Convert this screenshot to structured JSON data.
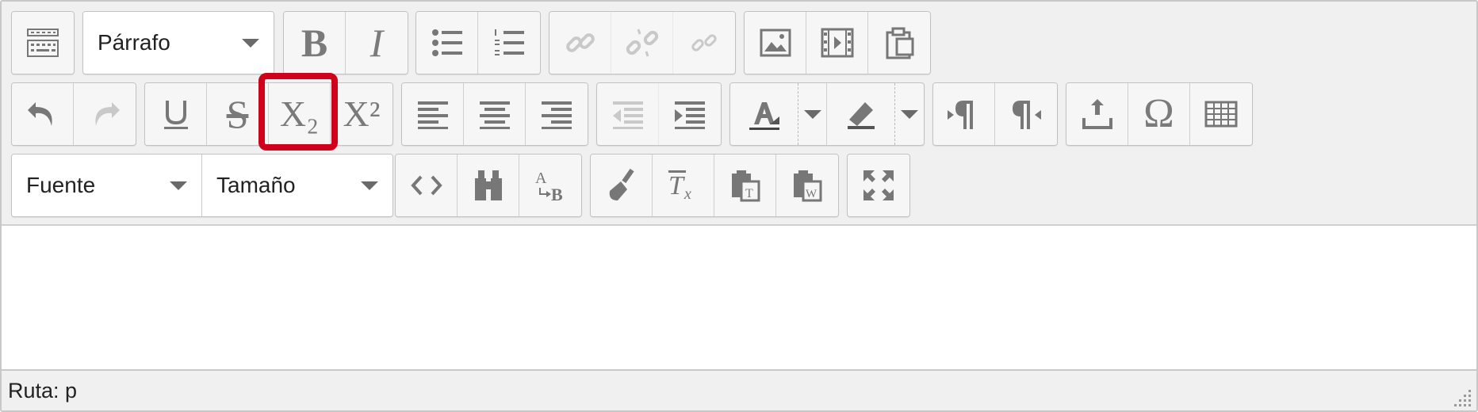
{
  "toolbar": {
    "row1": {
      "toggle_label": "Mostrar más botones",
      "format_select": "Párrafo",
      "bold": "B",
      "italic": "I"
    },
    "row2": {
      "strike": "S",
      "subscript": "X₂",
      "superscript": "X²",
      "special_char": "Ω"
    },
    "row3": {
      "font_select": "Fuente",
      "size_select": "Tamaño"
    }
  },
  "highlight": {
    "target": "subscript-button",
    "color": "#d0021b"
  },
  "content": {
    "text": ""
  },
  "statusbar": {
    "path": "Ruta: p"
  },
  "colors": {
    "toolbar_bg": "#f0f0f0",
    "icon": "#7a7a7a",
    "highlight": "#d0021b"
  }
}
